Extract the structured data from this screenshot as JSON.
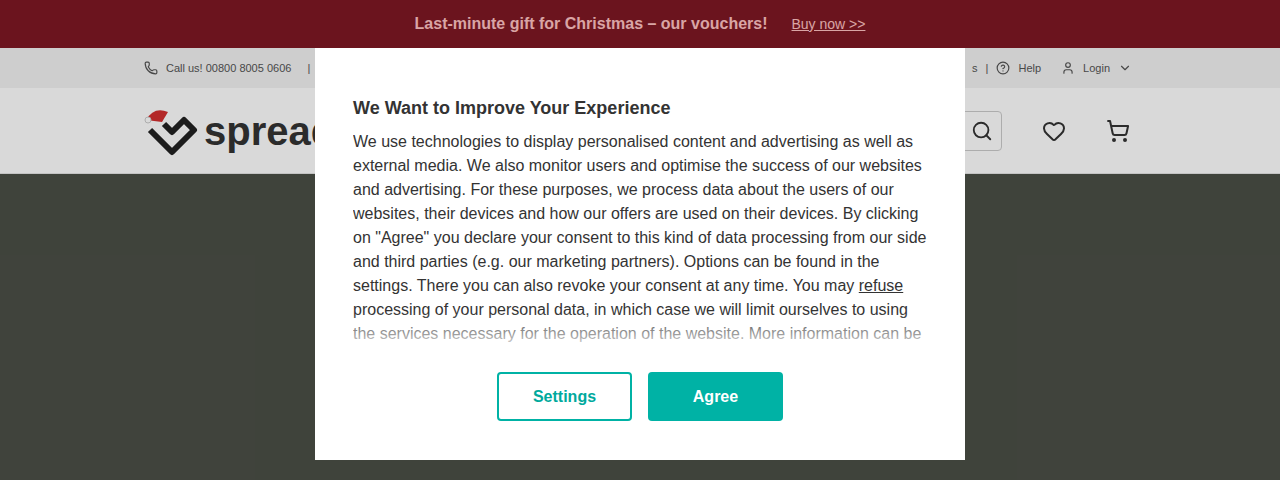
{
  "banner": {
    "text": "Last-minute gift for Christmas – our vouchers!",
    "link": "Buy now >>"
  },
  "topbar": {
    "phone": "Call us! 00800 8005 0606",
    "separator": "|",
    "right_items": [
      "s",
      "Help",
      "Login"
    ]
  },
  "logo": {
    "text": "spread"
  },
  "modal": {
    "title": "We Want to Improve Your Experience",
    "body_before": "We use technologies to display personalised content and advertising as well as external media. We also monitor users and optimise the success of our websites and advertising. For these purposes, we process data about the users of our websites, their devices and how our offers are used on their devices. By clicking on \"Agree\" you declare your consent to this kind of data processing from our side and third parties (e.g. our marketing partners). Options can be found in the settings. There you can also revoke your consent at any time. You may ",
    "link": "refuse",
    "body_after": " processing of your personal data, in which case we will limit ourselves to using the services necessary for the operation of the website. More information can be",
    "buttons": [
      {
        "label": "Settings",
        "kind": "outline"
      },
      {
        "label": "Agree",
        "kind": "filled"
      }
    ]
  }
}
